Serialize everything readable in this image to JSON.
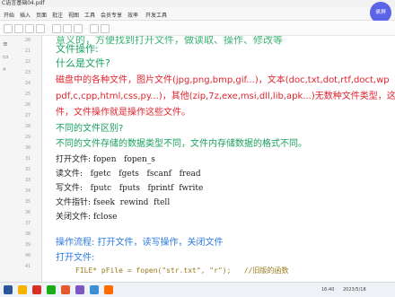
{
  "window": {
    "title": "C语言基础04.pdf"
  },
  "menu": {
    "items": [
      "开始",
      "插入",
      "页面",
      "批注",
      "视图",
      "工具",
      "会员专享",
      "效率",
      "开发工具"
    ]
  },
  "toolbar": {
    "record_button": "录屏"
  },
  "gutter": {
    "line_numbers": [
      "20",
      "21",
      "22",
      "23",
      "24",
      "25",
      "26",
      "27",
      "28",
      "29",
      "30",
      "31",
      "32",
      "33",
      "34",
      "35",
      "36",
      "37",
      "38",
      "39",
      "40",
      "41"
    ]
  },
  "content": {
    "top_partial": "意义的，方便找到打开文件，做读取、操作、修改等",
    "h_file_ops": "文件操作:",
    "h_what_is_file": "什么是文件?",
    "p_file_types_1": "磁盘中的各种文件，图片文件(jpg,png,bmp,gif...)，文本(doc,txt,dot,rtf,doct,wp",
    "p_file_types_2": "pdf,c,cpp,html,css,py...)，其他(zip,7z,exe,msi,dll,lib,apk...)无数种文件类型，这些都",
    "p_file_types_3": "件，文件操作就是操作这些文件。",
    "h_diff": "不同的文件区别?",
    "p_diff": "不同的文件存储的数据类型不同，文件内存储数据的格式不同。",
    "code_lines": [
      "打开文件: fopen   fopen_s",
      "读文件:   fgetc   fgets   fscanf   fread",
      "写文件:   fputc   fputs   fprintf  fwrite",
      "文件指针: fseek  rewind  ftell",
      "关闭文件: fclose"
    ],
    "h_flow": "操作流程: 打开文件，读写操作，关闭文件",
    "h_open": "打开文件:",
    "code_partial": "FILE* pFile = fopen(\"str.txt\", \"r\");   //旧版的函数"
  },
  "taskbar": {
    "time": "16:40",
    "date": "2023/5/18"
  },
  "colors": {
    "accent": "#5b63e6",
    "red": "#e0242f",
    "green": "#19a15f",
    "blue": "#2d7be0"
  }
}
